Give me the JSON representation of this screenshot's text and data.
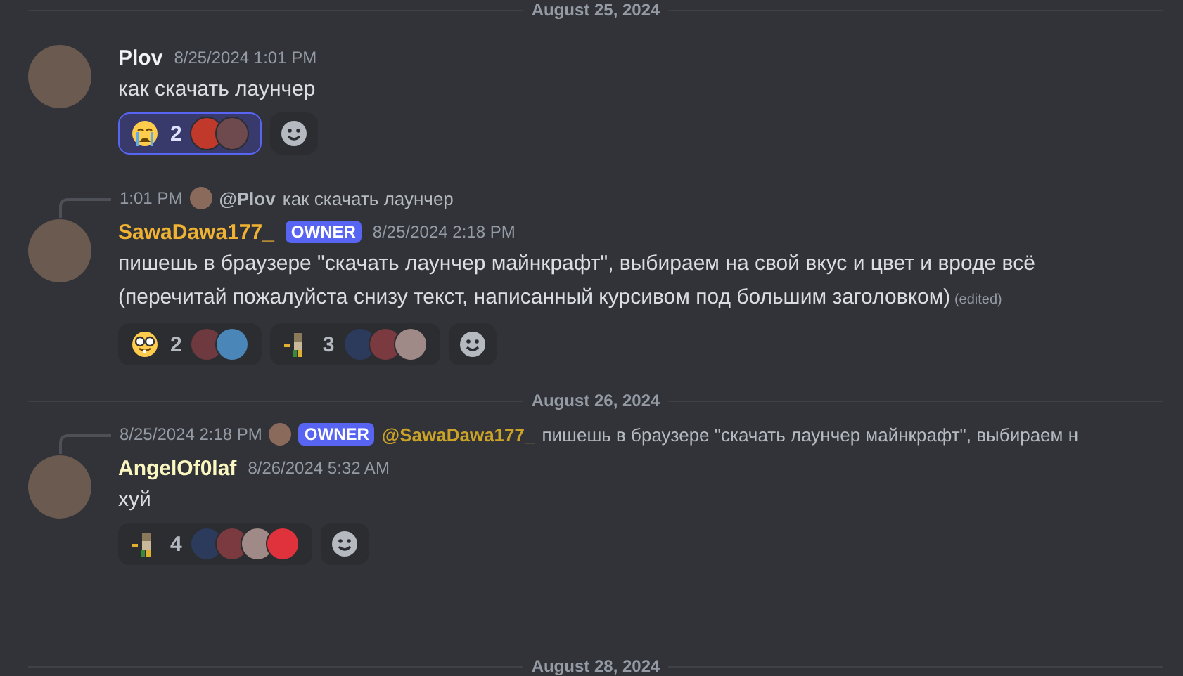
{
  "dividers_top": [
    {
      "label": "August 25, 2024"
    }
  ],
  "messages": [
    {
      "author": "Plov",
      "color": "#f2f3f5",
      "timestamp": "8/25/2024 1:01 PM",
      "text": "как скачать лаунчер",
      "reactions": [
        {
          "kind": "crying",
          "count": "2",
          "selected": true,
          "reactors": [
            {
              "color": "#c0392b"
            },
            {
              "color": "#6e4a4f"
            }
          ]
        }
      ]
    },
    {
      "reply": {
        "time": "1:01 PM",
        "mention": "@Plov",
        "color": "#b5bac1",
        "text": "как скачать лаунчер"
      },
      "author": "SawaDawa177_",
      "color": "#f0b232",
      "badge": "OWNER",
      "timestamp": "8/25/2024 2:18 PM",
      "text": "пишешь в браузере \"скачать лаунчер майнкрафт\", выбираем на свой вкус и цвет и вроде всё (перечитай пожалуйста снизу текст, написанный курсивом под большим заголовком)",
      "edited": "(edited)",
      "reactions": [
        {
          "kind": "nerd",
          "count": "2",
          "selected": false,
          "reactors": [
            {
              "color": "#6e3a3f"
            },
            {
              "color": "#4a86b8"
            }
          ]
        },
        {
          "kind": "sprite",
          "count": "3",
          "selected": false,
          "reactors": [
            {
              "color": "#2c3a5c"
            },
            {
              "color": "#7a3a3f"
            },
            {
              "color": "#a08a88"
            }
          ]
        }
      ]
    },
    {
      "divider": "August 26, 2024",
      "reply": {
        "time": "8/25/2024 2:18 PM",
        "badge": "OWNER",
        "mention": "@SawaDawa177_",
        "color": "#c9a227",
        "text": "пишешь в браузере \"скачать лаунчер майнкрафт\", выбираем н"
      },
      "author": "AngelOf0laf",
      "color": "#fbf7c0",
      "timestamp": "8/26/2024 5:32 AM",
      "text": "хуй",
      "reactions": [
        {
          "kind": "sprite",
          "count": "4",
          "selected": false,
          "reactors": [
            {
              "color": "#2c3a5c"
            },
            {
              "color": "#7a3a3f"
            },
            {
              "color": "#a08a88"
            },
            {
              "color": "#e0323c"
            }
          ]
        }
      ]
    }
  ],
  "dividers_bottom": [
    {
      "label": "August 28, 2024"
    }
  ]
}
